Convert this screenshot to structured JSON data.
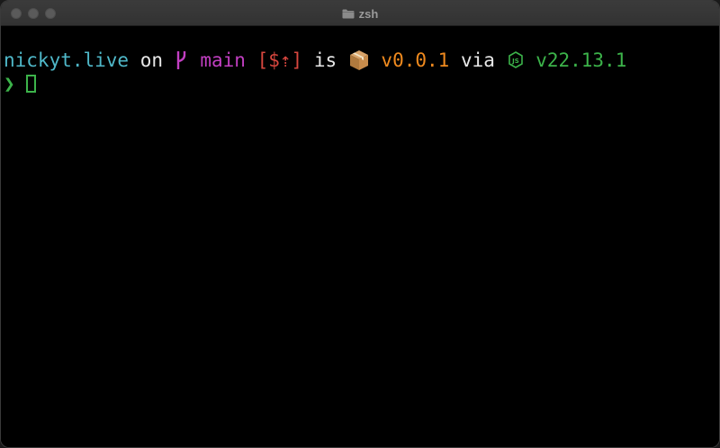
{
  "window": {
    "title": "zsh",
    "title_icon": "folder-icon"
  },
  "prompt": {
    "directory": "nickyt.live",
    "on_word": "on",
    "branch_icon": "git-branch-icon",
    "branch": "main",
    "git_status": "[$⇡]",
    "is_word": "is",
    "package_icon": "package-icon",
    "package_version": "v0.0.1",
    "via_word": "via",
    "node_icon": "nodejs-icon",
    "node_version": "v22.13.1",
    "prompt_char": "❯"
  },
  "colors": {
    "background": "#000000",
    "directory": "#4fb8c9",
    "branch": "#c23fc2",
    "status": "#d9473f",
    "package": "#f08a1e",
    "node": "#3cb34a",
    "text": "#e8e8e8"
  }
}
